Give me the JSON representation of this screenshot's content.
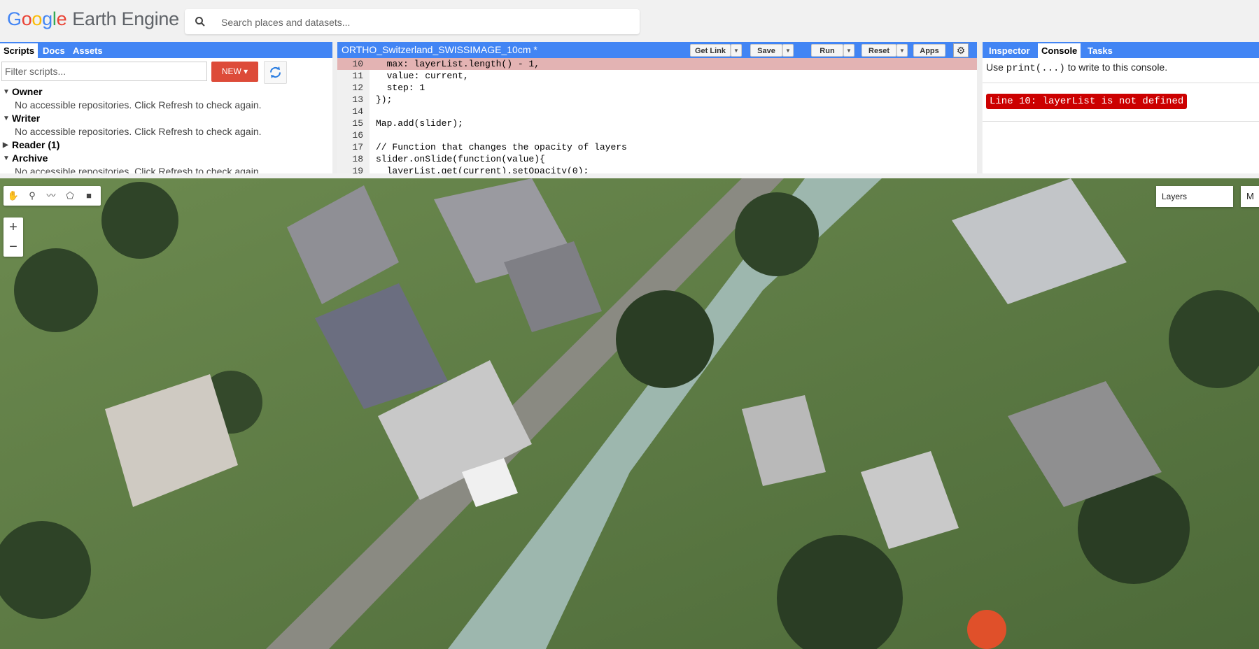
{
  "app": {
    "logo_google": "Google",
    "logo_rest": "Earth Engine"
  },
  "search": {
    "placeholder": "Search places and datasets..."
  },
  "left_panel": {
    "tabs": [
      "Scripts",
      "Docs",
      "Assets"
    ],
    "filter_placeholder": "Filter scripts...",
    "new_label": "NEW",
    "tree": [
      {
        "label": "Owner",
        "expanded": true,
        "message": "No accessible repositories. Click Refresh to check again."
      },
      {
        "label": "Writer",
        "expanded": true,
        "message": "No accessible repositories. Click Refresh to check again."
      },
      {
        "label": "Reader (1)",
        "expanded": false
      },
      {
        "label": "Archive",
        "expanded": true,
        "message": "No accessible repositories. Click Refresh to check again."
      }
    ]
  },
  "editor": {
    "title": "ORTHO_Switzerland_SWISSIMAGE_10cm *",
    "buttons": {
      "get_link": "Get Link",
      "save": "Save",
      "run": "Run",
      "reset": "Reset",
      "apps": "Apps"
    },
    "lines": [
      {
        "n": "10",
        "code": "  max: layerList.length() - 1,"
      },
      {
        "n": "11",
        "code": "  value: current,"
      },
      {
        "n": "12",
        "code": "  step: 1"
      },
      {
        "n": "13",
        "code": "});"
      },
      {
        "n": "14",
        "code": ""
      },
      {
        "n": "15",
        "code": "Map.add(slider);"
      },
      {
        "n": "16",
        "code": ""
      },
      {
        "n": "17",
        "code": "// Function that changes the opacity of layers"
      },
      {
        "n": "18",
        "code": "slider.onSlide(function(value){"
      },
      {
        "n": "19",
        "code": "  layerList.get(current).setOpacity(0);"
      }
    ]
  },
  "right_panel": {
    "tabs": [
      "Inspector",
      "Console",
      "Tasks"
    ],
    "hint_pre": "Use ",
    "hint_code": "print(...)",
    "hint_post": " to write to this console.",
    "error": "Line 10: layerList is not defined"
  },
  "map": {
    "zoom_in": "+",
    "zoom_out": "−",
    "layers_label": "Layers",
    "map_type_label": "M"
  }
}
